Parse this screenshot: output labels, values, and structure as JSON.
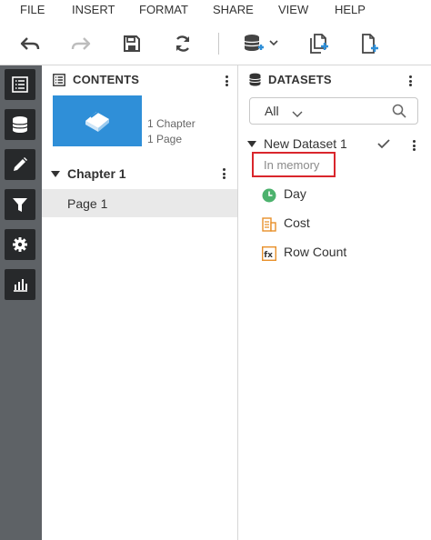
{
  "menu": {
    "file": "FILE",
    "insert": "INSERT",
    "format": "FORMAT",
    "share": "SHARE",
    "view": "VIEW",
    "help": "HELP"
  },
  "toolbar": {
    "icons": [
      "undo-icon",
      "redo-icon",
      "save-icon",
      "refresh-icon",
      "add-dataset-icon",
      "duplicate-page-icon",
      "new-page-icon"
    ]
  },
  "rail": {
    "icons": [
      "contents-list-icon",
      "datasets-icon",
      "edit-icon",
      "filter-icon",
      "settings-icon",
      "bar-chart-icon"
    ]
  },
  "contents": {
    "title": "CONTENTS",
    "thumbnail": {
      "chapters": "1 Chapter",
      "pages": "1 Page"
    },
    "chapter": "Chapter 1",
    "page": "Page 1"
  },
  "datasets": {
    "title": "DATASETS",
    "filter_value": "All",
    "dataset_name": "New Dataset 1",
    "dataset_status": "In memory",
    "fields": [
      {
        "label": "Day",
        "icon": "clock-icon"
      },
      {
        "label": "Cost",
        "icon": "measure-icon"
      },
      {
        "label": "Row Count",
        "icon": "formula-icon"
      }
    ]
  },
  "colors": {
    "accent_blue": "#2f8fd8",
    "rail_bg": "#5e6266",
    "rail_button": "#27292b",
    "highlight_red": "#d9262c",
    "clock_green": "#4cb26d",
    "field_orange": "#e8902a"
  }
}
